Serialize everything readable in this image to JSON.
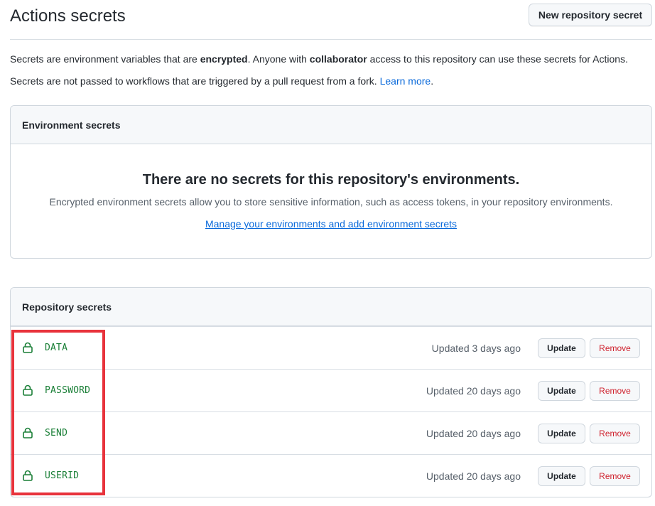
{
  "header": {
    "title": "Actions secrets",
    "new_button_label": "New repository secret"
  },
  "description": {
    "line1_a": "Secrets are environment variables that are ",
    "line1_b": "encrypted",
    "line1_c": ". Anyone with ",
    "line1_d": "collaborator",
    "line1_e": " access to this repository can use these secrets for Actions.",
    "line2_a": "Secrets are not passed to workflows that are triggered by a pull request from a fork. ",
    "line2_link": "Learn more",
    "line2_end": "."
  },
  "environment": {
    "heading": "Environment secrets",
    "blank_title": "There are no secrets for this repository's environments.",
    "blank_desc": "Encrypted environment secrets allow you to store sensitive information, such as access tokens, in your repository environments.",
    "blank_link": "Manage your environments and add environment secrets"
  },
  "repository": {
    "heading": "Repository secrets",
    "update_label": "Update",
    "remove_label": "Remove",
    "secrets": [
      {
        "name": "DATA",
        "updated": "Updated 3 days ago"
      },
      {
        "name": "PASSWORD",
        "updated": "Updated 20 days ago"
      },
      {
        "name": "SEND",
        "updated": "Updated 20 days ago"
      },
      {
        "name": "USERID",
        "updated": "Updated 20 days ago"
      }
    ]
  },
  "colors": {
    "accent": "#0969da",
    "secret_name": "#1a7f37",
    "danger": "#cf222e",
    "highlight": "#e8333c"
  }
}
